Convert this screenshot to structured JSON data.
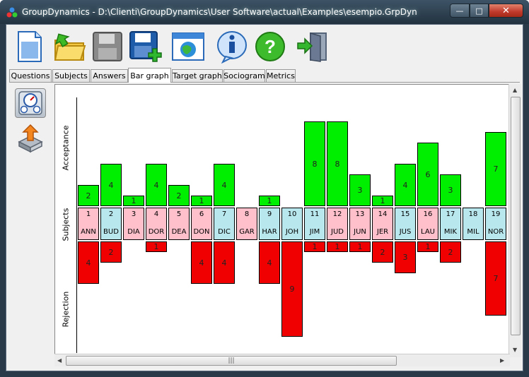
{
  "window": {
    "title": "GroupDynamics - D:\\Clienti\\GroupDynamics\\User Software\\actual\\Examples\\esempio.GrpDyn",
    "min_label": "—",
    "max_label": "□",
    "close_label": "✕"
  },
  "toolbar": {
    "buttons": [
      {
        "icon": "new-document-icon"
      },
      {
        "icon": "open-folder-icon"
      },
      {
        "icon": "save-disabled-icon"
      },
      {
        "icon": "save-as-icon"
      },
      {
        "icon": "browser-window-icon"
      },
      {
        "icon": "info-icon"
      },
      {
        "icon": "help-icon"
      },
      {
        "icon": "exit-door-icon"
      }
    ]
  },
  "tabs": [
    {
      "label": "Questions",
      "active": false
    },
    {
      "label": "Subjects",
      "active": false
    },
    {
      "label": "Answers",
      "active": false
    },
    {
      "label": "Bar graph",
      "active": true
    },
    {
      "label": "Target graph",
      "active": false
    },
    {
      "label": "Sociogram",
      "active": false
    },
    {
      "label": "Metrics",
      "active": false
    }
  ],
  "left_panel": [
    {
      "icon": "gauges-icon",
      "selected": true
    },
    {
      "icon": "export-arrow-icon",
      "selected": false
    }
  ],
  "graph": {
    "acceptance_label": "Acceptance",
    "subjects_label": "Subjects",
    "rejection_label": "Rejection",
    "colors": {
      "acceptance": "#00ee00",
      "rejection": "#f00000",
      "pink": "#ffc0cb",
      "blue": "#b8e8ee"
    },
    "subjects": [
      {
        "num": "1",
        "code": "ANN",
        "color": "pink",
        "acceptance": 2,
        "rejection": 4
      },
      {
        "num": "2",
        "code": "BUD",
        "color": "blue",
        "acceptance": 4,
        "rejection": 2
      },
      {
        "num": "3",
        "code": "DIA",
        "color": "pink",
        "acceptance": 1,
        "rejection": 0
      },
      {
        "num": "4",
        "code": "DOR",
        "color": "pink",
        "acceptance": 4,
        "rejection": 1
      },
      {
        "num": "5",
        "code": "DEA",
        "color": "pink",
        "acceptance": 2,
        "rejection": 0
      },
      {
        "num": "6",
        "code": "DON",
        "color": "pink",
        "acceptance": 1,
        "rejection": 4
      },
      {
        "num": "7",
        "code": "DIC",
        "color": "blue",
        "acceptance": 4,
        "rejection": 4
      },
      {
        "num": "8",
        "code": "GAR",
        "color": "pink",
        "acceptance": 0,
        "rejection": 0
      },
      {
        "num": "9",
        "code": "HAR",
        "color": "blue",
        "acceptance": 1,
        "rejection": 4
      },
      {
        "num": "10",
        "code": "JOH",
        "color": "blue",
        "acceptance": 0,
        "rejection": 9
      },
      {
        "num": "11",
        "code": "JIM",
        "color": "blue",
        "acceptance": 8,
        "rejection": 1
      },
      {
        "num": "12",
        "code": "JUD",
        "color": "pink",
        "acceptance": 8,
        "rejection": 1
      },
      {
        "num": "13",
        "code": "JUN",
        "color": "pink",
        "acceptance": 3,
        "rejection": 1
      },
      {
        "num": "14",
        "code": "JER",
        "color": "pink",
        "acceptance": 1,
        "rejection": 2
      },
      {
        "num": "15",
        "code": "JUS",
        "color": "blue",
        "acceptance": 4,
        "rejection": 3
      },
      {
        "num": "16",
        "code": "LAU",
        "color": "pink",
        "acceptance": 6,
        "rejection": 1
      },
      {
        "num": "17",
        "code": "MIK",
        "color": "blue",
        "acceptance": 3,
        "rejection": 2
      },
      {
        "num": "18",
        "code": "MIL",
        "color": "blue",
        "acceptance": 0,
        "rejection": 0
      },
      {
        "num": "19",
        "code": "NOR",
        "color": "blue",
        "acceptance": 7,
        "rejection": 7
      }
    ]
  },
  "scroll": {
    "grip": "|||",
    "left": "◀",
    "right": "▶",
    "up": "▲",
    "down": "▼"
  }
}
